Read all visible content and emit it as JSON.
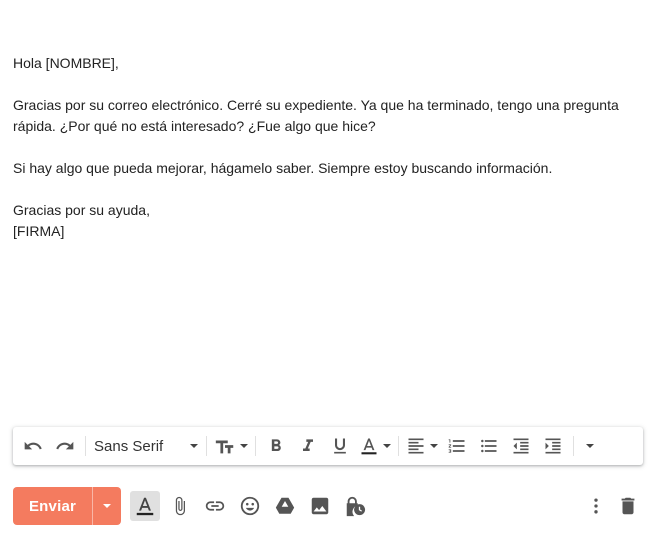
{
  "message": {
    "greeting": "Hola [NOMBRE],",
    "para1_line1": "Gracias por su correo electrónico. Cerré su expediente. Ya que ha terminado, tengo una pregunta",
    "para1_line2": "rápida. ¿Por qué no está interesado? ¿Fue algo que hice?",
    "para2": "Si hay algo que pueda mejorar, hágamelo saber. Siempre estoy buscando información.",
    "closing": "Gracias por su ayuda,",
    "signature": "[FIRMA]"
  },
  "format_toolbar": {
    "font_family": "Sans Serif",
    "icons": [
      "undo-icon",
      "redo-icon",
      "text-size-icon",
      "bold-icon",
      "italic-icon",
      "underline-icon",
      "text-color-icon",
      "align-icon",
      "numbered-list-icon",
      "bulleted-list-icon",
      "indent-less-icon",
      "indent-more-icon",
      "more-formatting-icon"
    ]
  },
  "bottom_bar": {
    "send_label": "Enviar",
    "send_color": "#f47b5f",
    "icons": [
      "formatting-options-icon",
      "attach-icon",
      "link-icon",
      "emoji-icon",
      "drive-icon",
      "photo-icon",
      "confidential-mode-icon",
      "more-options-icon",
      "discard-icon"
    ]
  }
}
